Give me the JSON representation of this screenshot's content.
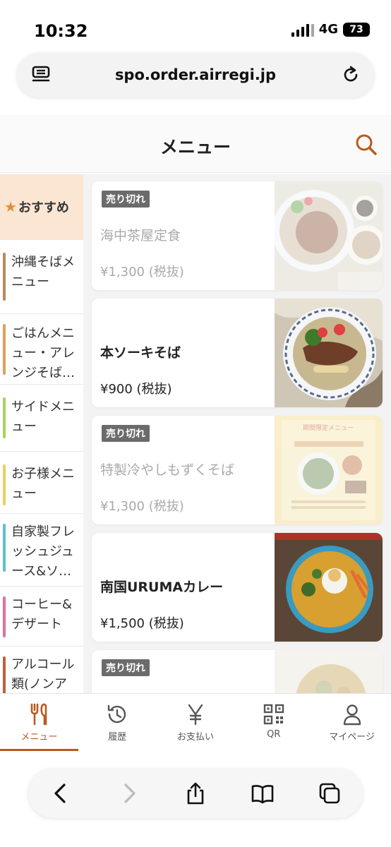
{
  "status_bar": {
    "time": "10:32",
    "network": "4G",
    "battery": "73"
  },
  "browser": {
    "url": "spo.order.airregi.jp"
  },
  "header": {
    "title": "メニュー"
  },
  "categories": [
    {
      "label": "おすすめ",
      "color": "#e48c3a"
    },
    {
      "label": "沖縄そばメニュー",
      "color": "#b88a5a"
    },
    {
      "label": "ごはんメニュー・アレンジそば…",
      "color": "#e0a060"
    },
    {
      "label": "サイドメニュー",
      "color": "#a8d060"
    },
    {
      "label": "お子様メニュー",
      "color": "#e8d060"
    },
    {
      "label": "自家製フレッシュジュース&ソ…",
      "color": "#60c0d0"
    },
    {
      "label": "コーヒー&デザート",
      "color": "#e070a0"
    },
    {
      "label": "アルコール類(ノンアルコール",
      "color": "#c06040"
    }
  ],
  "menu_items": [
    {
      "name": "海中茶屋定食",
      "price": "¥1,300 (税抜)",
      "badge": "売り切れ",
      "sold_out": true
    },
    {
      "name": "本ソーキそば",
      "price": "¥900 (税抜)",
      "badge": "",
      "sold_out": false
    },
    {
      "name": "特製冷やしもずくそば",
      "price": "¥1,300 (税抜)",
      "badge": "売り切れ",
      "sold_out": true
    },
    {
      "name": "南国URUMAカレー",
      "price": "¥1,500 (税抜)",
      "badge": "",
      "sold_out": false
    },
    {
      "name": "",
      "price": "",
      "badge": "売り切れ",
      "sold_out": true
    }
  ],
  "poster_text": "期間限定メニュー",
  "tabs": [
    {
      "label": "メニュー",
      "icon": "fork-knife-icon",
      "active": true
    },
    {
      "label": "履歴",
      "icon": "history-icon",
      "active": false
    },
    {
      "label": "お支払い",
      "icon": "yen-icon",
      "active": false
    },
    {
      "label": "QR",
      "icon": "qr-icon",
      "active": false
    },
    {
      "label": "マイページ",
      "icon": "person-icon",
      "active": false
    }
  ],
  "accent_color": "#b85a1f"
}
